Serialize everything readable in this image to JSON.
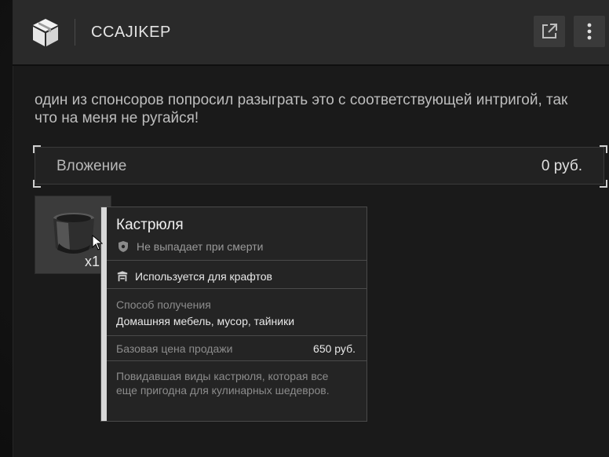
{
  "header": {
    "title": "CCAJIKEP",
    "box_icon": "box-icon",
    "open_icon": "external-link-icon",
    "more_icon": "more-vertical-icon"
  },
  "message": {
    "text": "один из спонсоров попросил разыграть это с соответствующей интригой, так что на меня не ругайся!"
  },
  "investment": {
    "label": "Вложение",
    "value": "0 руб."
  },
  "item_slot": {
    "quantity": "x1",
    "icon": "pot-icon"
  },
  "tooltip": {
    "name": "Кастрюля",
    "no_drop": "Не выпадает при смерти",
    "crafting": "Используется для крафтов",
    "source_label": "Способ получения",
    "source_value": "Домашняя мебель, мусор, тайники",
    "price_label": "Базовая цена продажи",
    "price_value": "650 руб.",
    "description": "Повидавшая виды кастрюля, которая все еще пригодна для кулинарных шедевров."
  },
  "colors": {
    "header_bg": "#2a2a2a",
    "panel_bg": "#1a1a1a",
    "tooltip_bg": "#242424",
    "accent": "#d8d8d8"
  }
}
